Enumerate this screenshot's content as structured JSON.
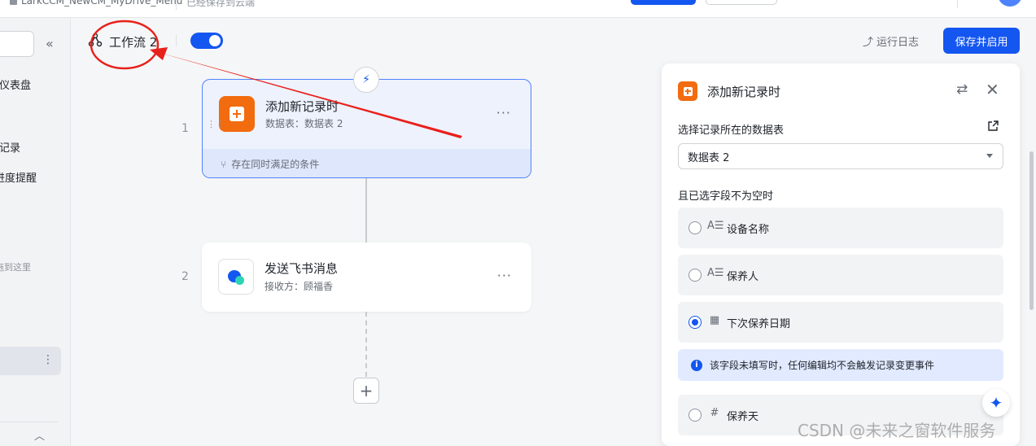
{
  "topbar": {
    "doc_title": "LarkCCM_NewCM_MyDrive_Menu",
    "save_status": "已经保存到云端"
  },
  "sidebar": {
    "items": [
      {
        "label": "仪表盘"
      },
      {
        "label": "记录"
      },
      {
        "label": "进度提醒"
      }
    ],
    "drop_hint": "拖到这里",
    "selected_more": "⋮"
  },
  "header": {
    "workflow_title": "工作流 2",
    "enabled": true,
    "run_log_label": "运行日志",
    "save_enable_label": "保存并启用"
  },
  "flow": {
    "steps": [
      {
        "number": "1",
        "title": "添加新记录时",
        "subtitle": "数据表：数据表 2",
        "condition": "存在同时满足的条件",
        "more": "···"
      },
      {
        "number": "2",
        "title": "发送飞书消息",
        "subtitle": "接收方：顾福香",
        "more": "···"
      }
    ]
  },
  "panel": {
    "title": "添加新记录时",
    "table_label": "选择记录所在的数据表",
    "table_value": "数据表 2",
    "field_label": "且已选字段不为空时",
    "fields": [
      {
        "type_icon": "A☰",
        "name": "设备名称",
        "checked": false
      },
      {
        "type_icon": "A☰",
        "name": "保养人",
        "checked": false
      },
      {
        "type_icon": "▦",
        "name": "下次保养日期",
        "checked": true
      },
      {
        "type_icon": "#",
        "name": "保养天",
        "checked": false
      }
    ],
    "notice": "该字段未填写时，任何编辑均不会触发记录变更事件"
  },
  "watermark": "CSDN @未来之窗软件服务",
  "colors": {
    "primary": "#1456f0",
    "trigger_orange": "#f26b0f",
    "annotation_red": "#e8201b"
  }
}
